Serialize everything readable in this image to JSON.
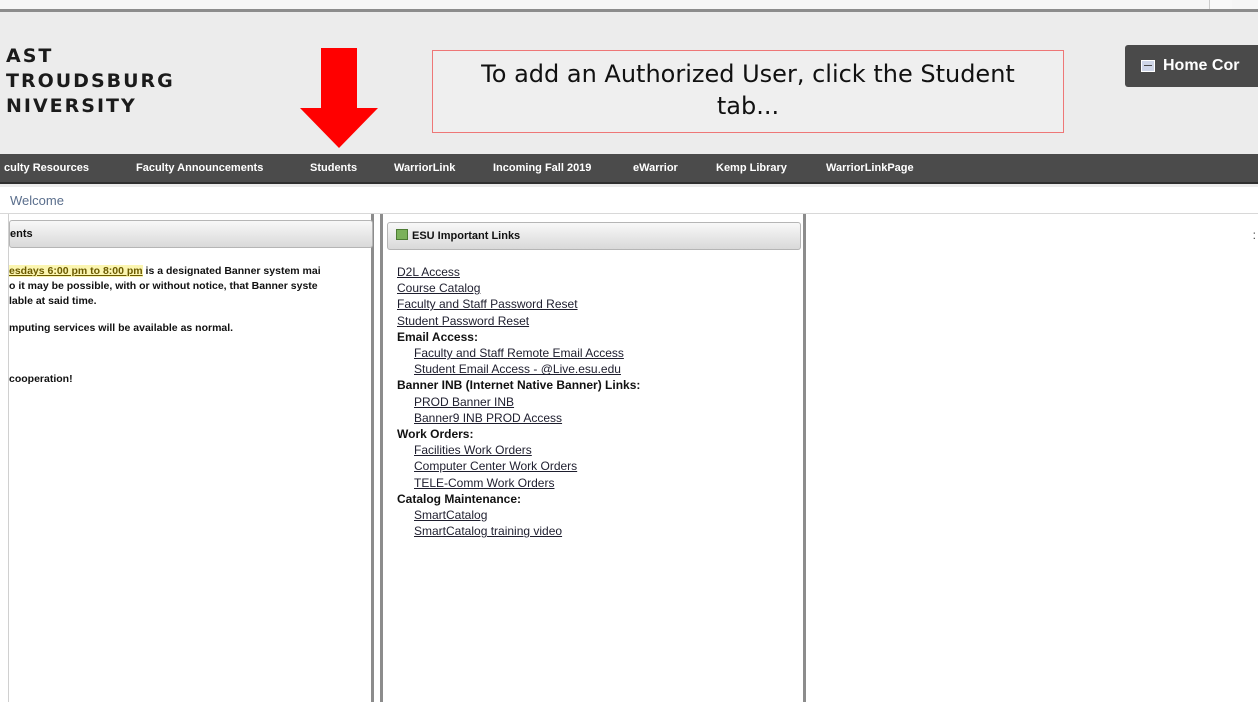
{
  "logo": {
    "lines": [
      "AST",
      "TROUDSBURG",
      "NIVERSITY"
    ]
  },
  "callout": {
    "line1": "To add an Authorized User, click the Student",
    "line2": "tab..."
  },
  "home_button": {
    "label": "Home Cor"
  },
  "nav": [
    "culty Resources",
    "Faculty Announcements",
    "Students",
    "WarriorLink",
    "Incoming Fall 2019",
    "eWarrior",
    "Kemp Library",
    "WarriorLinkPage"
  ],
  "breadcrumb": "Welcome",
  "announcements": {
    "title": "ents",
    "highlight": "esdays 6:00 pm to 8:00 pm",
    "line1_rest": " is a designated Banner system mai",
    "line2": "o it may be possible, with or without notice, that Banner syste",
    "line3": "lable at said time.",
    "line4": "mputing services will be available as normal.",
    "line5": "cooperation!"
  },
  "important_links": {
    "title": "ESU Important Links",
    "items": {
      "d2l": "D2L Access",
      "catalog": "Course Catalog",
      "fs_pw": "Faculty and Staff Password Reset",
      "st_pw": "Student Password Reset",
      "email_hdr": "Email Access:",
      "fs_email": "Faculty and Staff Remote Email Access",
      "st_email": "Student Email Access - @Live.esu.edu",
      "banner_hdr": "Banner INB (Internet Native Banner) Links:",
      "prod_inb": "PROD Banner INB",
      "banner9": "Banner9 INB PROD Access",
      "wo_hdr": "Work Orders:",
      "facilities": "Facilities Work Orders",
      "cc_wo": "Computer Center Work Orders",
      "tele": "TELE-Comm Work Orders",
      "cat_hdr": "Catalog Maintenance:",
      "smart": "SmartCatalog",
      "smart_video": "SmartCatalog training video"
    }
  },
  "colors": {
    "nav_bg": "#4b4b4b",
    "arrow": "#ff0000",
    "callout_border": "#e77777"
  }
}
